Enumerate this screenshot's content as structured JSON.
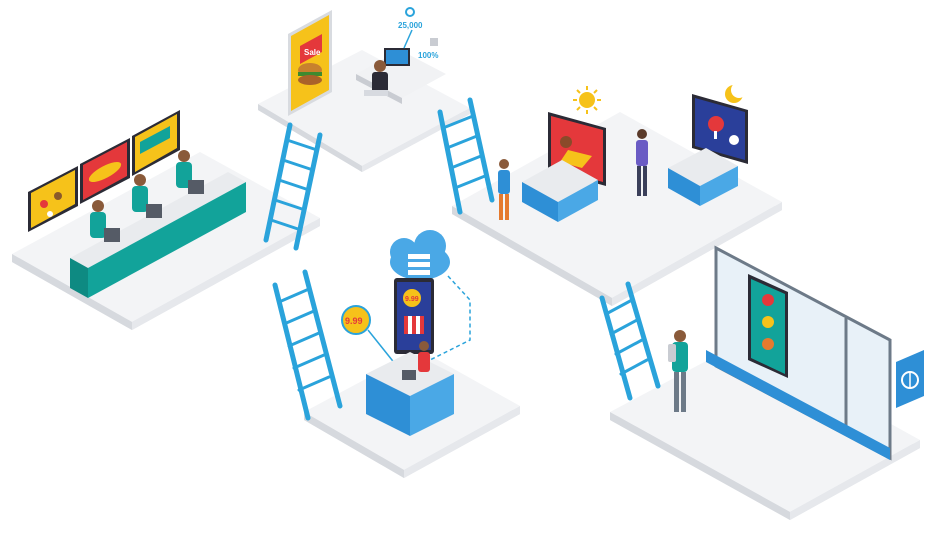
{
  "scene": {
    "description_labels": {
      "office_kpi_top": "25,000",
      "office_kpi_pct": "100%",
      "poster_sale": "Sale",
      "kiosk_price_badge": "9.99",
      "kiosk_screen_price": "9.99"
    },
    "colors": {
      "platform_top": "#f4f5f7",
      "platform_side": "#dcdfe4",
      "ladder": "#2aa3db",
      "counter_teal": "#12a39a",
      "counter_blue": "#2e8fd6",
      "accent_yellow": "#f6c21a",
      "accent_red": "#e4383b"
    },
    "icons": [
      "ladder-icon",
      "cloud-icon",
      "sun-icon",
      "moon-icon",
      "pizza-icon"
    ]
  }
}
